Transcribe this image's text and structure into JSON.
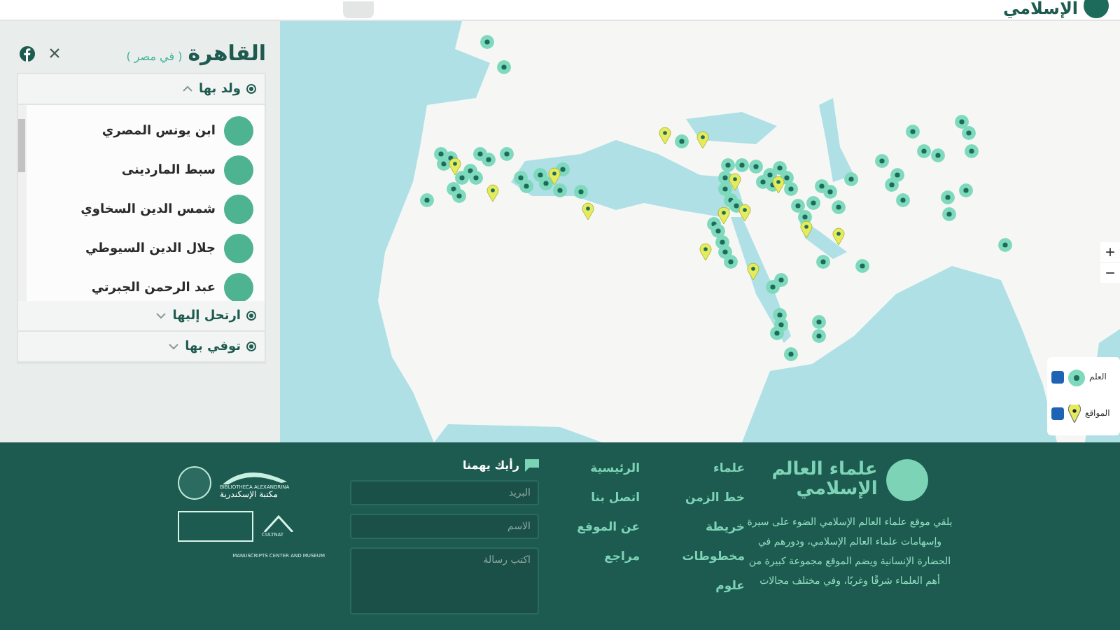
{
  "header": {
    "logo_text": "الإسلامي"
  },
  "place_panel": {
    "title": "القاهرة",
    "subtitle": "( في مصر )",
    "sections": [
      {
        "label": "ولد بها",
        "expanded": true,
        "people": [
          "ابن يونس المصري",
          "سبط الماردينى",
          "شمس الدين السخاوي",
          "جلال الدين السيوطي",
          "عبد الرحمن الجبرتي"
        ]
      },
      {
        "label": "ارتحل إليها",
        "expanded": false
      },
      {
        "label": "توفي بها",
        "expanded": false
      }
    ]
  },
  "map": {
    "zoom_controls": [
      "+",
      "−"
    ],
    "legend": [
      {
        "label": "العلم",
        "kind": "scholar",
        "checked": true
      },
      {
        "label": "المواقع",
        "kind": "site",
        "checked": true
      }
    ]
  },
  "footer": {
    "brand": {
      "logo_line_1": "علماء العالم",
      "logo_line_2": "الإسلامي",
      "description": "يلقي موقع علماء العالم الإسلامي الضوء على سيرة وإسهامات علماء العالم الإسلامي، ودورهم في الحضارة الإنسانية ويضم الموقع مجموعة كبيرة من أهم العلماء شرقًا وغربًا، وفي مختلف مجالات"
    },
    "links_1": [
      "علماء",
      "خط الزمن",
      "خريطة",
      "مخطوطات",
      "علوم"
    ],
    "links_2": [
      "الرئيسية",
      "اتصل بنا",
      "عن الموقع",
      "مراجع"
    ],
    "feedback": {
      "title": "رأيك يهمنا",
      "email_placeholder": "البريد",
      "name_placeholder": "الاسم",
      "message_placeholder": "اكتب رسالة"
    },
    "partners": {
      "library_en": "BIBLIOTHECA ALEXANDRINA",
      "library_ar": "مكتبة الإسكندرية",
      "cultnat": "CULTNAT",
      "manuscripts": "MANUSCRIPTS CENTER AND MUSEUM"
    }
  }
}
